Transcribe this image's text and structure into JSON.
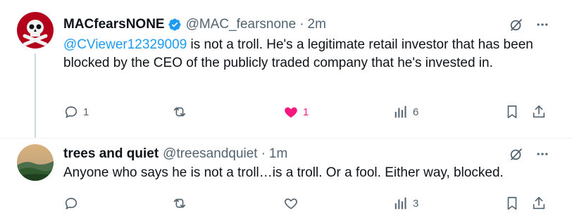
{
  "tweets": [
    {
      "display_name": "MACfearsNONE",
      "handle": "@MAC_fearsnone",
      "separator": "·",
      "time": "2m",
      "mention": "@CViewer12329009",
      "text": " is not a troll. He's a legitimate retail investor that has been blocked by the CEO of the publicly traded company that he's invested in.",
      "replies": "1",
      "reposts": "",
      "likes": "1",
      "views": "6",
      "liked": true
    },
    {
      "display_name": "trees and quiet",
      "handle": "@treesandquiet",
      "separator": "·",
      "time": "1m",
      "text": "Anyone who says he is not a troll…is a troll.  Or a fool.  Either way, blocked.",
      "replies": "",
      "reposts": "",
      "likes": "",
      "views": "3",
      "liked": false
    }
  ],
  "colors": {
    "accent": "#1d9bf0",
    "like": "#f91880",
    "muted": "#536471"
  }
}
